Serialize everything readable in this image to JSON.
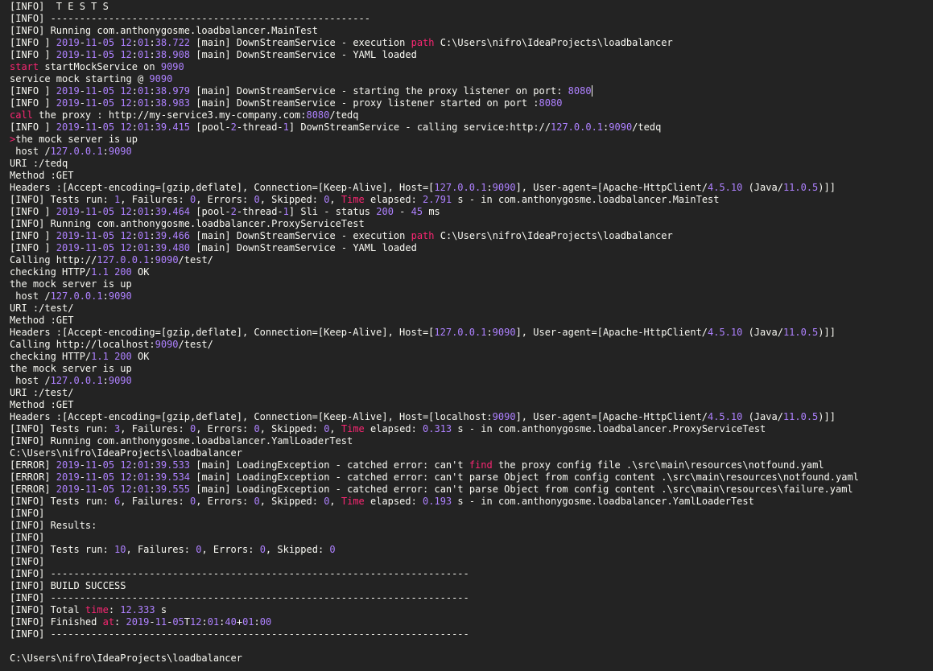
{
  "colors": {
    "default": "#f8f8f2",
    "number": "#ae81ff",
    "keyword": "#f92672"
  },
  "lines": [
    [
      [
        "t",
        "[INFO]  T E S T S"
      ]
    ],
    [
      [
        "t",
        "[INFO] -------------------------------------------------------"
      ]
    ],
    [
      [
        "t",
        "[INFO] Running com.anthonygosme.loadbalancer.MainTest"
      ]
    ],
    [
      [
        "t",
        "[INFO ] "
      ],
      [
        "n",
        "2019"
      ],
      [
        "t",
        "-"
      ],
      [
        "n",
        "11"
      ],
      [
        "t",
        "-"
      ],
      [
        "n",
        "05"
      ],
      [
        "t",
        " "
      ],
      [
        "n",
        "12"
      ],
      [
        "t",
        ":"
      ],
      [
        "n",
        "01"
      ],
      [
        "t",
        ":"
      ],
      [
        "n",
        "38.722"
      ],
      [
        "t",
        " [main] DownStreamService - execution "
      ],
      [
        "k",
        "path"
      ],
      [
        "t",
        " C:\\Users\\nifro\\IdeaProjects\\loadbalancer"
      ]
    ],
    [
      [
        "t",
        "[INFO ] "
      ],
      [
        "n",
        "2019"
      ],
      [
        "t",
        "-"
      ],
      [
        "n",
        "11"
      ],
      [
        "t",
        "-"
      ],
      [
        "n",
        "05"
      ],
      [
        "t",
        " "
      ],
      [
        "n",
        "12"
      ],
      [
        "t",
        ":"
      ],
      [
        "n",
        "01"
      ],
      [
        "t",
        ":"
      ],
      [
        "n",
        "38.908"
      ],
      [
        "t",
        " [main] DownStreamService - YAML loaded"
      ]
    ],
    [
      [
        "k",
        "start"
      ],
      [
        "t",
        " startMockService on "
      ],
      [
        "n",
        "9090"
      ]
    ],
    [
      [
        "t",
        "service mock starting @ "
      ],
      [
        "n",
        "9090"
      ]
    ],
    [
      [
        "t",
        "[INFO ] "
      ],
      [
        "n",
        "2019"
      ],
      [
        "t",
        "-"
      ],
      [
        "n",
        "11"
      ],
      [
        "t",
        "-"
      ],
      [
        "n",
        "05"
      ],
      [
        "t",
        " "
      ],
      [
        "n",
        "12"
      ],
      [
        "t",
        ":"
      ],
      [
        "n",
        "01"
      ],
      [
        "t",
        ":"
      ],
      [
        "n",
        "38.979"
      ],
      [
        "t",
        " [main] DownStreamService - starting the proxy listener on port: "
      ],
      [
        "n",
        "8080"
      ],
      [
        "c",
        ""
      ]
    ],
    [
      [
        "t",
        "[INFO ] "
      ],
      [
        "n",
        "2019"
      ],
      [
        "t",
        "-"
      ],
      [
        "n",
        "11"
      ],
      [
        "t",
        "-"
      ],
      [
        "n",
        "05"
      ],
      [
        "t",
        " "
      ],
      [
        "n",
        "12"
      ],
      [
        "t",
        ":"
      ],
      [
        "n",
        "01"
      ],
      [
        "t",
        ":"
      ],
      [
        "n",
        "38.983"
      ],
      [
        "t",
        " [main] DownStreamService - proxy listener started on port :"
      ],
      [
        "n",
        "8080"
      ]
    ],
    [
      [
        "k",
        "call"
      ],
      [
        "t",
        " the proxy : http://my-service3.my-company.com:"
      ],
      [
        "n",
        "8080"
      ],
      [
        "t",
        "/tedq"
      ]
    ],
    [
      [
        "t",
        "[INFO ] "
      ],
      [
        "n",
        "2019"
      ],
      [
        "t",
        "-"
      ],
      [
        "n",
        "11"
      ],
      [
        "t",
        "-"
      ],
      [
        "n",
        "05"
      ],
      [
        "t",
        " "
      ],
      [
        "n",
        "12"
      ],
      [
        "t",
        ":"
      ],
      [
        "n",
        "01"
      ],
      [
        "t",
        ":"
      ],
      [
        "n",
        "39.415"
      ],
      [
        "t",
        " [pool-"
      ],
      [
        "n",
        "2"
      ],
      [
        "t",
        "-thread-"
      ],
      [
        "n",
        "1"
      ],
      [
        "t",
        "] DownStreamService - calling service:http://"
      ],
      [
        "n",
        "127.0.0.1"
      ],
      [
        "t",
        ":"
      ],
      [
        "n",
        "9090"
      ],
      [
        "t",
        "/tedq"
      ]
    ],
    [
      [
        "k",
        ">"
      ],
      [
        "t",
        "the mock server is up"
      ]
    ],
    [
      [
        "t",
        " host /"
      ],
      [
        "n",
        "127.0.0.1"
      ],
      [
        "t",
        ":"
      ],
      [
        "n",
        "9090"
      ]
    ],
    [
      [
        "t",
        "URI :/tedq"
      ]
    ],
    [
      [
        "t",
        "Method :GET"
      ]
    ],
    [
      [
        "t",
        "Headers :[Accept-encoding=[gzip,deflate], Connection=[Keep-Alive], Host=["
      ],
      [
        "n",
        "127.0.0.1"
      ],
      [
        "t",
        ":"
      ],
      [
        "n",
        "9090"
      ],
      [
        "t",
        "], User-agent=[Apache-HttpClient/"
      ],
      [
        "n",
        "4.5.10"
      ],
      [
        "t",
        " (Java/"
      ],
      [
        "n",
        "11.0.5"
      ],
      [
        "t",
        ")]]"
      ]
    ],
    [
      [
        "t",
        "[INFO] Tests run: "
      ],
      [
        "n",
        "1"
      ],
      [
        "t",
        ", Failures: "
      ],
      [
        "n",
        "0"
      ],
      [
        "t",
        ", Errors: "
      ],
      [
        "n",
        "0"
      ],
      [
        "t",
        ", Skipped: "
      ],
      [
        "n",
        "0"
      ],
      [
        "t",
        ", "
      ],
      [
        "k",
        "Time"
      ],
      [
        "t",
        " elapsed: "
      ],
      [
        "n",
        "2.791"
      ],
      [
        "t",
        " s - in com.anthonygosme.loadbalancer.MainTest"
      ]
    ],
    [
      [
        "t",
        "[INFO ] "
      ],
      [
        "n",
        "2019"
      ],
      [
        "t",
        "-"
      ],
      [
        "n",
        "11"
      ],
      [
        "t",
        "-"
      ],
      [
        "n",
        "05"
      ],
      [
        "t",
        " "
      ],
      [
        "n",
        "12"
      ],
      [
        "t",
        ":"
      ],
      [
        "n",
        "01"
      ],
      [
        "t",
        ":"
      ],
      [
        "n",
        "39.464"
      ],
      [
        "t",
        " [pool-"
      ],
      [
        "n",
        "2"
      ],
      [
        "t",
        "-thread-"
      ],
      [
        "n",
        "1"
      ],
      [
        "t",
        "] Sli - status "
      ],
      [
        "n",
        "200"
      ],
      [
        "t",
        " - "
      ],
      [
        "n",
        "45"
      ],
      [
        "t",
        " ms"
      ]
    ],
    [
      [
        "t",
        "[INFO] Running com.anthonygosme.loadbalancer.ProxyServiceTest"
      ]
    ],
    [
      [
        "t",
        "[INFO ] "
      ],
      [
        "n",
        "2019"
      ],
      [
        "t",
        "-"
      ],
      [
        "n",
        "11"
      ],
      [
        "t",
        "-"
      ],
      [
        "n",
        "05"
      ],
      [
        "t",
        " "
      ],
      [
        "n",
        "12"
      ],
      [
        "t",
        ":"
      ],
      [
        "n",
        "01"
      ],
      [
        "t",
        ":"
      ],
      [
        "n",
        "39.466"
      ],
      [
        "t",
        " [main] DownStreamService - execution "
      ],
      [
        "k",
        "path"
      ],
      [
        "t",
        " C:\\Users\\nifro\\IdeaProjects\\loadbalancer"
      ]
    ],
    [
      [
        "t",
        "[INFO ] "
      ],
      [
        "n",
        "2019"
      ],
      [
        "t",
        "-"
      ],
      [
        "n",
        "11"
      ],
      [
        "t",
        "-"
      ],
      [
        "n",
        "05"
      ],
      [
        "t",
        " "
      ],
      [
        "n",
        "12"
      ],
      [
        "t",
        ":"
      ],
      [
        "n",
        "01"
      ],
      [
        "t",
        ":"
      ],
      [
        "n",
        "39.480"
      ],
      [
        "t",
        " [main] DownStreamService - YAML loaded"
      ]
    ],
    [
      [
        "t",
        "Calling http://"
      ],
      [
        "n",
        "127.0.0.1"
      ],
      [
        "t",
        ":"
      ],
      [
        "n",
        "9090"
      ],
      [
        "t",
        "/test/"
      ]
    ],
    [
      [
        "t",
        "checking HTTP/"
      ],
      [
        "n",
        "1.1"
      ],
      [
        "t",
        " "
      ],
      [
        "n",
        "200"
      ],
      [
        "t",
        " OK"
      ]
    ],
    [
      [
        "t",
        "the mock server is up"
      ]
    ],
    [
      [
        "t",
        " host /"
      ],
      [
        "n",
        "127.0.0.1"
      ],
      [
        "t",
        ":"
      ],
      [
        "n",
        "9090"
      ]
    ],
    [
      [
        "t",
        "URI :/test/"
      ]
    ],
    [
      [
        "t",
        "Method :GET"
      ]
    ],
    [
      [
        "t",
        "Headers :[Accept-encoding=[gzip,deflate], Connection=[Keep-Alive], Host=["
      ],
      [
        "n",
        "127.0.0.1"
      ],
      [
        "t",
        ":"
      ],
      [
        "n",
        "9090"
      ],
      [
        "t",
        "], User-agent=[Apache-HttpClient/"
      ],
      [
        "n",
        "4.5.10"
      ],
      [
        "t",
        " (Java/"
      ],
      [
        "n",
        "11.0.5"
      ],
      [
        "t",
        ")]]"
      ]
    ],
    [
      [
        "t",
        "Calling http://localhost:"
      ],
      [
        "n",
        "9090"
      ],
      [
        "t",
        "/test/"
      ]
    ],
    [
      [
        "t",
        "checking HTTP/"
      ],
      [
        "n",
        "1.1"
      ],
      [
        "t",
        " "
      ],
      [
        "n",
        "200"
      ],
      [
        "t",
        " OK"
      ]
    ],
    [
      [
        "t",
        "the mock server is up"
      ]
    ],
    [
      [
        "t",
        " host /"
      ],
      [
        "n",
        "127.0.0.1"
      ],
      [
        "t",
        ":"
      ],
      [
        "n",
        "9090"
      ]
    ],
    [
      [
        "t",
        "URI :/test/"
      ]
    ],
    [
      [
        "t",
        "Method :GET"
      ]
    ],
    [
      [
        "t",
        "Headers :[Accept-encoding=[gzip,deflate], Connection=[Keep-Alive], Host=[localhost:"
      ],
      [
        "n",
        "9090"
      ],
      [
        "t",
        "], User-agent=[Apache-HttpClient/"
      ],
      [
        "n",
        "4.5.10"
      ],
      [
        "t",
        " (Java/"
      ],
      [
        "n",
        "11.0.5"
      ],
      [
        "t",
        ")]]"
      ]
    ],
    [
      [
        "t",
        "[INFO] Tests run: "
      ],
      [
        "n",
        "3"
      ],
      [
        "t",
        ", Failures: "
      ],
      [
        "n",
        "0"
      ],
      [
        "t",
        ", Errors: "
      ],
      [
        "n",
        "0"
      ],
      [
        "t",
        ", Skipped: "
      ],
      [
        "n",
        "0"
      ],
      [
        "t",
        ", "
      ],
      [
        "k",
        "Time"
      ],
      [
        "t",
        " elapsed: "
      ],
      [
        "n",
        "0.313"
      ],
      [
        "t",
        " s - in com.anthonygosme.loadbalancer.ProxyServiceTest"
      ]
    ],
    [
      [
        "t",
        "[INFO] Running com.anthonygosme.loadbalancer.YamlLoaderTest"
      ]
    ],
    [
      [
        "t",
        "C:\\Users\\nifro\\IdeaProjects\\loadbalancer"
      ]
    ],
    [
      [
        "t",
        "[ERROR] "
      ],
      [
        "n",
        "2019"
      ],
      [
        "t",
        "-"
      ],
      [
        "n",
        "11"
      ],
      [
        "t",
        "-"
      ],
      [
        "n",
        "05"
      ],
      [
        "t",
        " "
      ],
      [
        "n",
        "12"
      ],
      [
        "t",
        ":"
      ],
      [
        "n",
        "01"
      ],
      [
        "t",
        ":"
      ],
      [
        "n",
        "39.533"
      ],
      [
        "t",
        " [main] LoadingException - catched error: can't "
      ],
      [
        "k",
        "find"
      ],
      [
        "t",
        " the proxy config file .\\src\\main\\resources\\notfound.yaml"
      ]
    ],
    [
      [
        "t",
        "[ERROR] "
      ],
      [
        "n",
        "2019"
      ],
      [
        "t",
        "-"
      ],
      [
        "n",
        "11"
      ],
      [
        "t",
        "-"
      ],
      [
        "n",
        "05"
      ],
      [
        "t",
        " "
      ],
      [
        "n",
        "12"
      ],
      [
        "t",
        ":"
      ],
      [
        "n",
        "01"
      ],
      [
        "t",
        ":"
      ],
      [
        "n",
        "39.534"
      ],
      [
        "t",
        " [main] LoadingException - catched error: can't parse Object from config content .\\src\\main\\resources\\notfound.yaml"
      ]
    ],
    [
      [
        "t",
        "[ERROR] "
      ],
      [
        "n",
        "2019"
      ],
      [
        "t",
        "-"
      ],
      [
        "n",
        "11"
      ],
      [
        "t",
        "-"
      ],
      [
        "n",
        "05"
      ],
      [
        "t",
        " "
      ],
      [
        "n",
        "12"
      ],
      [
        "t",
        ":"
      ],
      [
        "n",
        "01"
      ],
      [
        "t",
        ":"
      ],
      [
        "n",
        "39.555"
      ],
      [
        "t",
        " [main] LoadingException - catched error: can't parse Object from config content .\\src\\main\\resources\\failure.yaml"
      ]
    ],
    [
      [
        "t",
        "[INFO] Tests run: "
      ],
      [
        "n",
        "6"
      ],
      [
        "t",
        ", Failures: "
      ],
      [
        "n",
        "0"
      ],
      [
        "t",
        ", Errors: "
      ],
      [
        "n",
        "0"
      ],
      [
        "t",
        ", Skipped: "
      ],
      [
        "n",
        "0"
      ],
      [
        "t",
        ", "
      ],
      [
        "k",
        "Time"
      ],
      [
        "t",
        " elapsed: "
      ],
      [
        "n",
        "0.193"
      ],
      [
        "t",
        " s - in com.anthonygosme.loadbalancer.YamlLoaderTest"
      ]
    ],
    [
      [
        "t",
        "[INFO]"
      ]
    ],
    [
      [
        "t",
        "[INFO] Results:"
      ]
    ],
    [
      [
        "t",
        "[INFO]"
      ]
    ],
    [
      [
        "t",
        "[INFO] Tests run: "
      ],
      [
        "n",
        "10"
      ],
      [
        "t",
        ", Failures: "
      ],
      [
        "n",
        "0"
      ],
      [
        "t",
        ", Errors: "
      ],
      [
        "n",
        "0"
      ],
      [
        "t",
        ", Skipped: "
      ],
      [
        "n",
        "0"
      ]
    ],
    [
      [
        "t",
        "[INFO]"
      ]
    ],
    [
      [
        "t",
        "[INFO] ------------------------------------------------------------------------"
      ]
    ],
    [
      [
        "t",
        "[INFO] BUILD SUCCESS"
      ]
    ],
    [
      [
        "t",
        "[INFO] ------------------------------------------------------------------------"
      ]
    ],
    [
      [
        "t",
        "[INFO] Total "
      ],
      [
        "k",
        "time"
      ],
      [
        "t",
        ": "
      ],
      [
        "n",
        "12.333"
      ],
      [
        "t",
        " s"
      ]
    ],
    [
      [
        "t",
        "[INFO] Finished "
      ],
      [
        "k",
        "at"
      ],
      [
        "t",
        ": "
      ],
      [
        "n",
        "2019"
      ],
      [
        "t",
        "-"
      ],
      [
        "n",
        "11"
      ],
      [
        "t",
        "-"
      ],
      [
        "n",
        "05"
      ],
      [
        "t",
        "T"
      ],
      [
        "n",
        "12"
      ],
      [
        "t",
        ":"
      ],
      [
        "n",
        "01"
      ],
      [
        "t",
        ":"
      ],
      [
        "n",
        "40"
      ],
      [
        "t",
        "+"
      ],
      [
        "n",
        "01"
      ],
      [
        "t",
        ":"
      ],
      [
        "n",
        "00"
      ]
    ],
    [
      [
        "t",
        "[INFO] ------------------------------------------------------------------------"
      ]
    ],
    [
      [
        "t",
        ""
      ]
    ],
    [
      [
        "t",
        "C:\\Users\\nifro\\IdeaProjects\\loadbalancer"
      ]
    ]
  ]
}
